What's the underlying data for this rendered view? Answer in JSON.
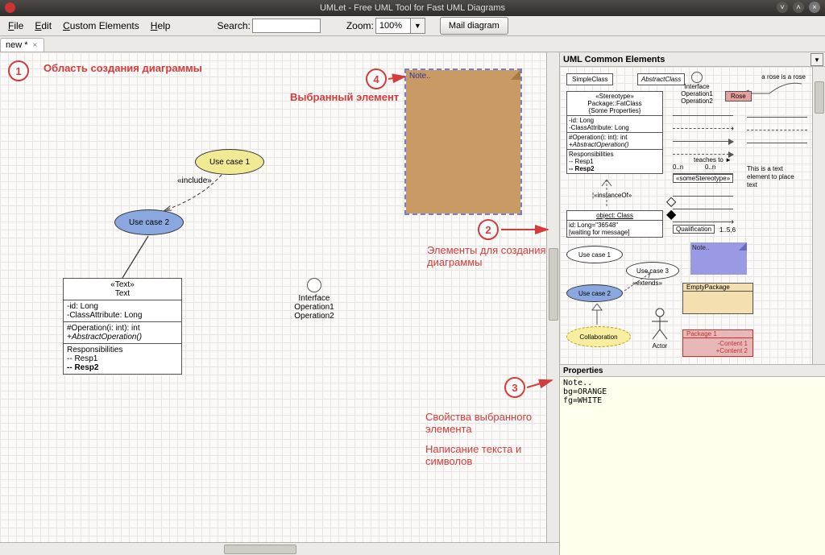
{
  "title": "UMLet - Free UML Tool for Fast UML Diagrams",
  "menu": {
    "file": "File",
    "edit": "Edit",
    "custom": "Custom Elements",
    "help": "Help",
    "search_label": "Search:",
    "zoom_label": "Zoom:",
    "zoom_value": "100%",
    "mail": "Mail diagram"
  },
  "tab": {
    "name": "new *",
    "close": "×"
  },
  "annotations": {
    "n1": "1",
    "a1": "Область создания диаграммы",
    "n4": "4",
    "a4": "Выбранный элемент",
    "n2": "2",
    "a2": "Элементы для создания диаграммы",
    "n3": "3",
    "a3a": "Свойства выбранного элемента",
    "a3b": "Написание текста и символов"
  },
  "canvas": {
    "usecase1": "Use case 1",
    "usecase2": "Use case 2",
    "include": "«include»",
    "note": "Note..",
    "class": {
      "hd1": "«Text»",
      "hd2": "Text",
      "attr1": "-id: Long",
      "attr2": "-ClassAttribute: Long",
      "op1": "#Operation(i: int): int",
      "op2": "+AbstractOperation()",
      "resp_hd": "Responsibilities",
      "resp1": "-- Resp1",
      "resp2": "-- Resp2"
    },
    "iface": {
      "label": "Interface",
      "op1": "Operation1",
      "op2": "Operation2"
    }
  },
  "palette": {
    "header": "UML Common Elements",
    "simple": "SimpleClass",
    "abstract": "AbstractClass",
    "iface": {
      "label": "Interface",
      "op1": "Operation1",
      "op2": "Operation2"
    },
    "rose": "a rose is a rose",
    "rosebox": "Rose",
    "stereo": {
      "hd1": "«Stereotype»",
      "hd2": "Package::FatClass",
      "hd3": "{Some Properties}",
      "a1": "-id: Long",
      "a2": "-ClassAttribute: Long",
      "o1": "#Operation(i: int): int",
      "o2": "+AbstractOperation()",
      "r0": "Responsibilities",
      "r1": "-- Resp1",
      "r2": "-- Resp2"
    },
    "instanceof": "¦«instanceOf»",
    "object": {
      "hd": "object: Class",
      "l1": "id: Long=\"36548\"",
      "l2": "[waiting for message]"
    },
    "teaches": "teaches to ►",
    "range": "0..n",
    "stereol": "«someStereotype»",
    "thisis": "This is a text element to place text",
    "qual": "Qualification",
    "qrange": "1..5,6",
    "uc1": "Use case 1",
    "uc2": "Use case 2",
    "uc3": "Use case 3",
    "ext": "«extends»",
    "collab": "Collaboration",
    "actor": "Actor",
    "pnote": "Note..",
    "empty": "EmptyPackage",
    "pack": {
      "name": "Package 1",
      "c1": "-Content 1",
      "c2": "+Content 2"
    }
  },
  "properties": {
    "header": "Properties",
    "text": "Note..\nbg=ORANGE\nfg=WHITE"
  }
}
